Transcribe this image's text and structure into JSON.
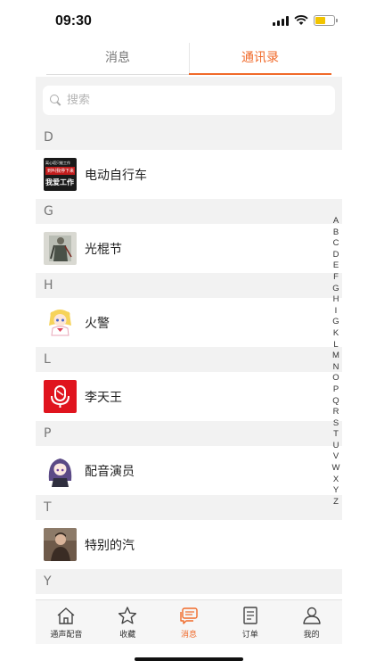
{
  "status_bar": {
    "time": "09:30"
  },
  "tabs": [
    {
      "label": "消息",
      "active": false
    },
    {
      "label": "通讯录",
      "active": true
    }
  ],
  "search": {
    "placeholder": "搜索"
  },
  "sections": [
    {
      "letter": "D",
      "contact": {
        "name": "电动自行车",
        "avatar": "poster-avatar"
      }
    },
    {
      "letter": "G",
      "contact": {
        "name": "光棍节",
        "avatar": "figure-avatar"
      }
    },
    {
      "letter": "H",
      "contact": {
        "name": "火警",
        "avatar": "anime-girl-avatar"
      }
    },
    {
      "letter": "L",
      "contact": {
        "name": "李天王",
        "avatar": "red-logo-avatar"
      }
    },
    {
      "letter": "P",
      "contact": {
        "name": "配音演员",
        "avatar": "anime-purple-avatar"
      }
    },
    {
      "letter": "T",
      "contact": {
        "name": "特别的汽",
        "avatar": "person-photo-avatar"
      }
    },
    {
      "letter": "Y",
      "contact": null
    }
  ],
  "poster_avatar_text": {
    "line1": "离心塔只能工作",
    "line2": "到叫我停下来",
    "line3": "我爱工作"
  },
  "index_letters": [
    "A",
    "B",
    "C",
    "D",
    "E",
    "F",
    "G",
    "H",
    "I",
    "G",
    "K",
    "L",
    "M",
    "N",
    "O",
    "P",
    "Q",
    "R",
    "S",
    "T",
    "U",
    "V",
    "W",
    "X",
    "Y",
    "Z"
  ],
  "bottom_tabs": [
    {
      "label": "通声配音",
      "icon": "home-icon",
      "active": false
    },
    {
      "label": "收藏",
      "icon": "star-icon",
      "active": false
    },
    {
      "label": "消息",
      "icon": "chat-icon",
      "active": true
    },
    {
      "label": "订单",
      "icon": "document-icon",
      "active": false
    },
    {
      "label": "我的",
      "icon": "person-icon",
      "active": false
    }
  ],
  "colors": {
    "accent": "#f06a2a",
    "panel_bg": "#f2f2f2"
  }
}
